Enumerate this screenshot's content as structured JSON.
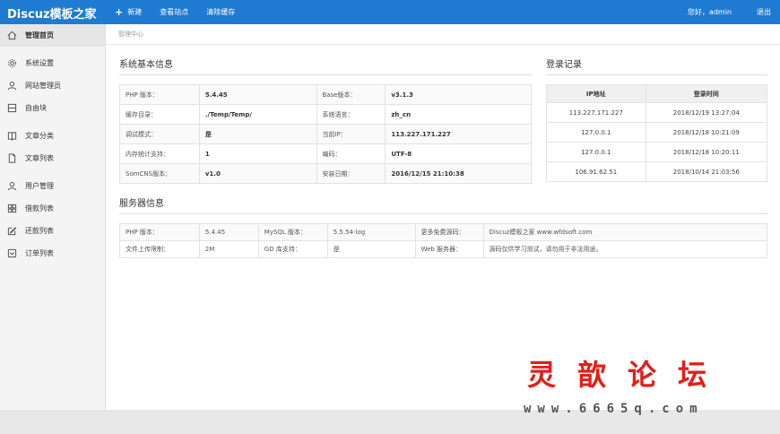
{
  "header": {
    "logo": "Discuz模板之家",
    "nav": [
      {
        "label": "新建",
        "icon": "plus-icon"
      },
      {
        "label": "查看站点"
      },
      {
        "label": "清除缓存"
      }
    ],
    "greeting": "您好，admin",
    "logout": "退出"
  },
  "sidebar": {
    "items": [
      {
        "label": "管理首页",
        "icon": "home-icon"
      },
      {
        "label": "系统设置",
        "icon": "gear-icon"
      },
      {
        "label": "网站管理员",
        "icon": "user-icon"
      },
      {
        "label": "自由块",
        "icon": "block-icon"
      },
      {
        "label": "文章分类",
        "icon": "book-icon"
      },
      {
        "label": "文章列表",
        "icon": "file-icon"
      },
      {
        "label": "用户管理",
        "icon": "user-icon"
      },
      {
        "label": "借款列表",
        "icon": "grid-icon"
      },
      {
        "label": "还款列表",
        "icon": "edit-icon"
      },
      {
        "label": "订单列表",
        "icon": "box-icon"
      }
    ]
  },
  "breadcrumb": "管理中心",
  "system_info": {
    "title": "系统基本信息",
    "rows": [
      [
        "PHP 版本：",
        "5.4.45",
        "Base版本：",
        "v3.1.3"
      ],
      [
        "缓存目录：",
        "./Temp/Temp/",
        "系统语言：",
        "zh_cn"
      ],
      [
        "调试模式：",
        "是",
        "当前IP：",
        "113.227.171.227"
      ],
      [
        "内存统计支持：",
        "1",
        "编码：",
        "UTF-8"
      ],
      [
        "SomCNS版本：",
        "v1.0",
        "安装日期：",
        "2016/12/15 21:10:38"
      ]
    ]
  },
  "login_records": {
    "title": "登录记录",
    "headers": [
      "IP地址",
      "登录时间"
    ],
    "rows": [
      [
        "113.227.171.227",
        "2018/12/19 13:27:04"
      ],
      [
        "127.0.0.1",
        "2018/12/18 10:21:09"
      ],
      [
        "127.0.0.1",
        "2018/12/18 10:20:11"
      ],
      [
        "106.91.62.51",
        "2018/10/14 21:03:56"
      ]
    ]
  },
  "server_info": {
    "title": "服务器信息",
    "rows": [
      [
        "PHP 版本：",
        "5.4.45",
        "MySQL 版本：",
        "5.5.54-log",
        "更多免费源码：",
        "Discuz模板之家 www.wfdsoft.com"
      ],
      [
        "文件上传限制：",
        "2M",
        "GD 库支持：",
        "是",
        "Web 服务器：",
        "源码仅供学习测试，请勿用于非法用途。"
      ]
    ]
  },
  "watermark": {
    "title": "灵歆论坛",
    "url": "www.6665q.com",
    "color": "#e0201a"
  },
  "colors": {
    "brand": "#1f7bd1"
  }
}
